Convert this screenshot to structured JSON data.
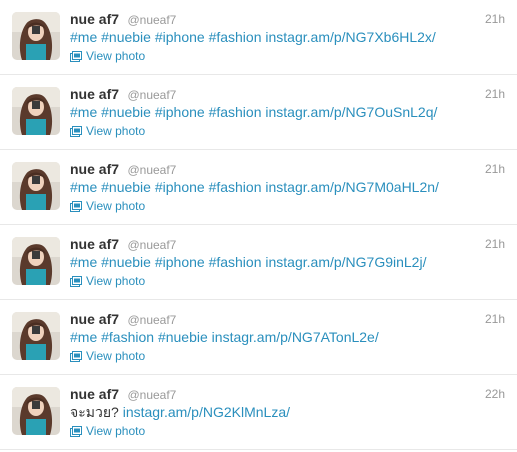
{
  "tweets": [
    {
      "fullname": "nue af7",
      "username": "@nueaf7",
      "time": "21h",
      "tokens": [
        "#me",
        " ",
        "#nuebie",
        " ",
        "#iphone",
        " ",
        "#fashion",
        " ",
        "instagr.am/p/NG7Xb6HL2x/"
      ],
      "action": "View photo"
    },
    {
      "fullname": "nue af7",
      "username": "@nueaf7",
      "time": "21h",
      "tokens": [
        "#me",
        " ",
        "#nuebie",
        " ",
        "#iphone",
        " ",
        "#fashion",
        " ",
        "instagr.am/p/NG7OuSnL2q/"
      ],
      "action": "View photo"
    },
    {
      "fullname": "nue af7",
      "username": "@nueaf7",
      "time": "21h",
      "tokens": [
        "#me",
        " ",
        "#nuebie",
        " ",
        "#iphone",
        " ",
        "#fashion",
        " ",
        "instagr.am/p/NG7M0aHL2n/"
      ],
      "action": "View photo"
    },
    {
      "fullname": "nue af7",
      "username": "@nueaf7",
      "time": "21h",
      "tokens": [
        "#me",
        " ",
        "#nuebie",
        " ",
        "#iphone",
        " ",
        "#fashion",
        " ",
        "instagr.am/p/NG7G9inL2j/"
      ],
      "action": "View photo"
    },
    {
      "fullname": "nue af7",
      "username": "@nueaf7",
      "time": "21h",
      "tokens": [
        "#me",
        " ",
        "#fashion",
        " ",
        "#nuebie",
        " ",
        "instagr.am/p/NG7ATonL2e/"
      ],
      "action": "View photo"
    },
    {
      "fullname": "nue af7",
      "username": "@nueaf7",
      "time": "22h",
      "tokens": [
        "จะมวย?",
        " ",
        "instagr.am/p/NG2KlMnLza/"
      ],
      "action": "View photo"
    }
  ],
  "colors": {
    "link": "#2a8fbd",
    "name": "#333333",
    "meta": "#999999",
    "divider": "#e8e8e8"
  },
  "icons": {
    "action": "photo-icon",
    "avatar": "avatar-image"
  }
}
